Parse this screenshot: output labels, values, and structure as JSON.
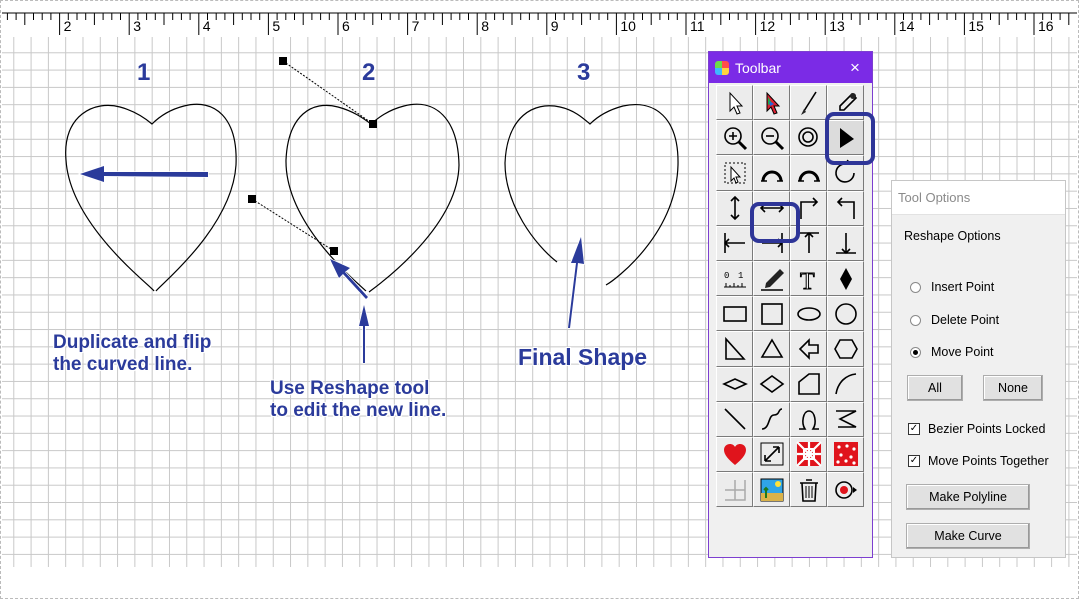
{
  "ruler": {
    "labels": [
      "2",
      "3",
      "4",
      "5",
      "6",
      "7",
      "8",
      "9",
      "10",
      "11",
      "12",
      "13",
      "14",
      "15",
      "16"
    ]
  },
  "annotations": {
    "step1": "1",
    "step2": "2",
    "step3": "3",
    "caption1_line1": "Duplicate and flip",
    "caption1_line2": "the curved line.",
    "caption2_line1": "Use Reshape tool",
    "caption2_line2": "to edit the new line.",
    "caption3": "Final Shape"
  },
  "toolbar": {
    "title": "Toolbar",
    "close": "×",
    "tools": [
      "select-arrow",
      "color-select-arrow",
      "paintbrush",
      "eyedropper",
      "zoom-in",
      "zoom-out",
      "zoom-fit",
      "reshape-arrow",
      "select-box",
      "arc-left",
      "arc-right",
      "rotate",
      "flip-vertical",
      "flip-horizontal",
      "corner-right",
      "corner-left",
      "align-left",
      "align-right",
      "align-top",
      "align-bottom",
      "ruler-measure",
      "pen",
      "text",
      "diamond-fill",
      "rectangle",
      "square",
      "ellipse",
      "circle",
      "right-triangle",
      "triangle",
      "arrow-shape",
      "hexagon",
      "flat-diamond",
      "diamond",
      "quarter-shape",
      "arc-line",
      "straight-line",
      "curve-line",
      "loop",
      "zigzag",
      "heart",
      "resize",
      "quilt-block",
      "fabric-swatch",
      "block-grid",
      "landscape-image",
      "trash",
      "record"
    ]
  },
  "tool_options": {
    "title": "Tool Options",
    "section": "Reshape Options",
    "insert_point": "Insert Point",
    "delete_point": "Delete Point",
    "move_point": "Move Point",
    "selected_mode": "Move Point",
    "all_button": "All",
    "none_button": "None",
    "bezier_locked": "Bezier Points Locked",
    "bezier_locked_checked": true,
    "move_together": "Move Points Together",
    "move_together_checked": true,
    "make_polyline": "Make Polyline",
    "make_curve": "Make Curve"
  },
  "colors": {
    "accent": "#7b2be6",
    "highlight": "#2e3598",
    "annotation": "#2b3b9b"
  }
}
